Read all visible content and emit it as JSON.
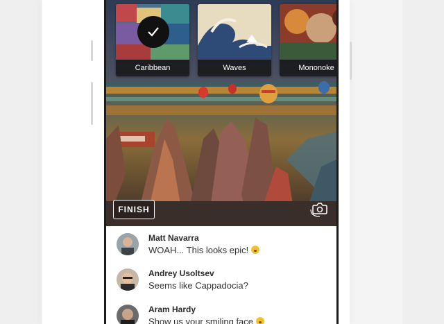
{
  "styles": [
    {
      "label": "Caribbean",
      "selected": true
    },
    {
      "label": "Waves",
      "selected": false
    },
    {
      "label": "Mononoke",
      "selected": false
    }
  ],
  "camera": {
    "finish_label": "FINISH",
    "switch_icon": "camera-switch-icon"
  },
  "comments": [
    {
      "name": "Matt Navarra",
      "text": "WOAH... This looks epic!",
      "emoji": "astonished-face"
    },
    {
      "name": "Andrey Usoltsev",
      "text": "Seems like Cappadocia?",
      "emoji": ""
    },
    {
      "name": "Aram Hardy",
      "text": "Show us your smiling face",
      "emoji": "smiling-face"
    }
  ],
  "colors": {
    "selected_check_bg": "#111111",
    "label_bar": "#141414",
    "comment_name": "#2a2a2a"
  }
}
